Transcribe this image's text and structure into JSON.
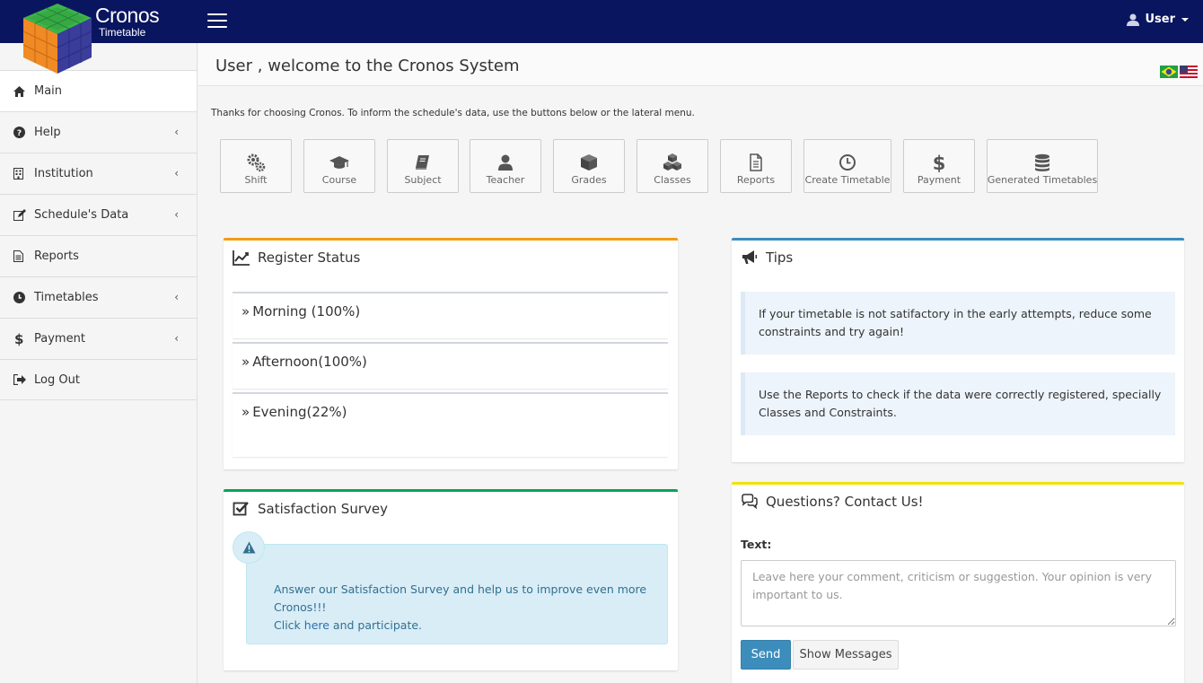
{
  "brand": {
    "name": "Cronos",
    "subtitle": "Timetable"
  },
  "user_menu": {
    "label": "User"
  },
  "sidebar": {
    "items": [
      {
        "label": "Main",
        "icon": "home-icon"
      },
      {
        "label": "Help",
        "icon": "question-circle-icon"
      },
      {
        "label": "Institution",
        "icon": "building-icon"
      },
      {
        "label": "Schedule's Data",
        "icon": "edit-icon"
      },
      {
        "label": "Reports",
        "icon": "file-text-icon"
      },
      {
        "label": "Timetables",
        "icon": "clock-icon"
      },
      {
        "label": "Payment",
        "icon": "dollar-icon"
      },
      {
        "label": "Log Out",
        "icon": "sign-out-icon"
      }
    ]
  },
  "page": {
    "title": "User , welcome to the Cronos System",
    "intro": "Thanks for choosing Cronos. To inform the schedule's data, use the buttons below or the lateral menu."
  },
  "quick_buttons": [
    {
      "label": "Shift",
      "icon": "gears-icon"
    },
    {
      "label": "Course",
      "icon": "graduation-cap-icon"
    },
    {
      "label": "Subject",
      "icon": "book-icon"
    },
    {
      "label": "Teacher",
      "icon": "user-icon"
    },
    {
      "label": "Grades",
      "icon": "cube-icon"
    },
    {
      "label": "Classes",
      "icon": "cubes-icon"
    },
    {
      "label": "Reports",
      "icon": "file-icon"
    },
    {
      "label": "Create Timetable",
      "icon": "clock-icon"
    },
    {
      "label": "Payment",
      "icon": "dollar-icon"
    },
    {
      "label": "Generated Timetables",
      "icon": "database-icon"
    }
  ],
  "register_status": {
    "title": "Register Status",
    "rows": [
      {
        "label": "Morning (100%)"
      },
      {
        "label": "Afternoon(100%)"
      },
      {
        "label": "Evening(22%)"
      }
    ]
  },
  "survey": {
    "title": "Satisfaction Survey",
    "line1": "Answer our Satisfaction Survey and help us to improve even more Cronos!!!",
    "click": "Click ",
    "link": "here",
    "after": " and participate."
  },
  "tips": {
    "title": "Tips",
    "items": [
      "If your timetable is not satifactory in the early attempts, reduce some constraints and try again!",
      "Use the Reports to check if the data were correctly registered, specially Classes and Constraints."
    ]
  },
  "contact": {
    "title": "Questions? Contact Us!",
    "label": "Text:",
    "placeholder": "Leave here your comment, criticism or suggestion. Your opinion is very important to us.",
    "send": "Send",
    "show": "Show Messages"
  },
  "colors": {
    "navbar": "#0a1560",
    "status_box_top": "#f39c12",
    "survey_box_top": "#00a65a",
    "tips_box_top": "#3c8dbc",
    "contact_box_top": "#f3e10a",
    "send_button": "#3c8dbc"
  }
}
